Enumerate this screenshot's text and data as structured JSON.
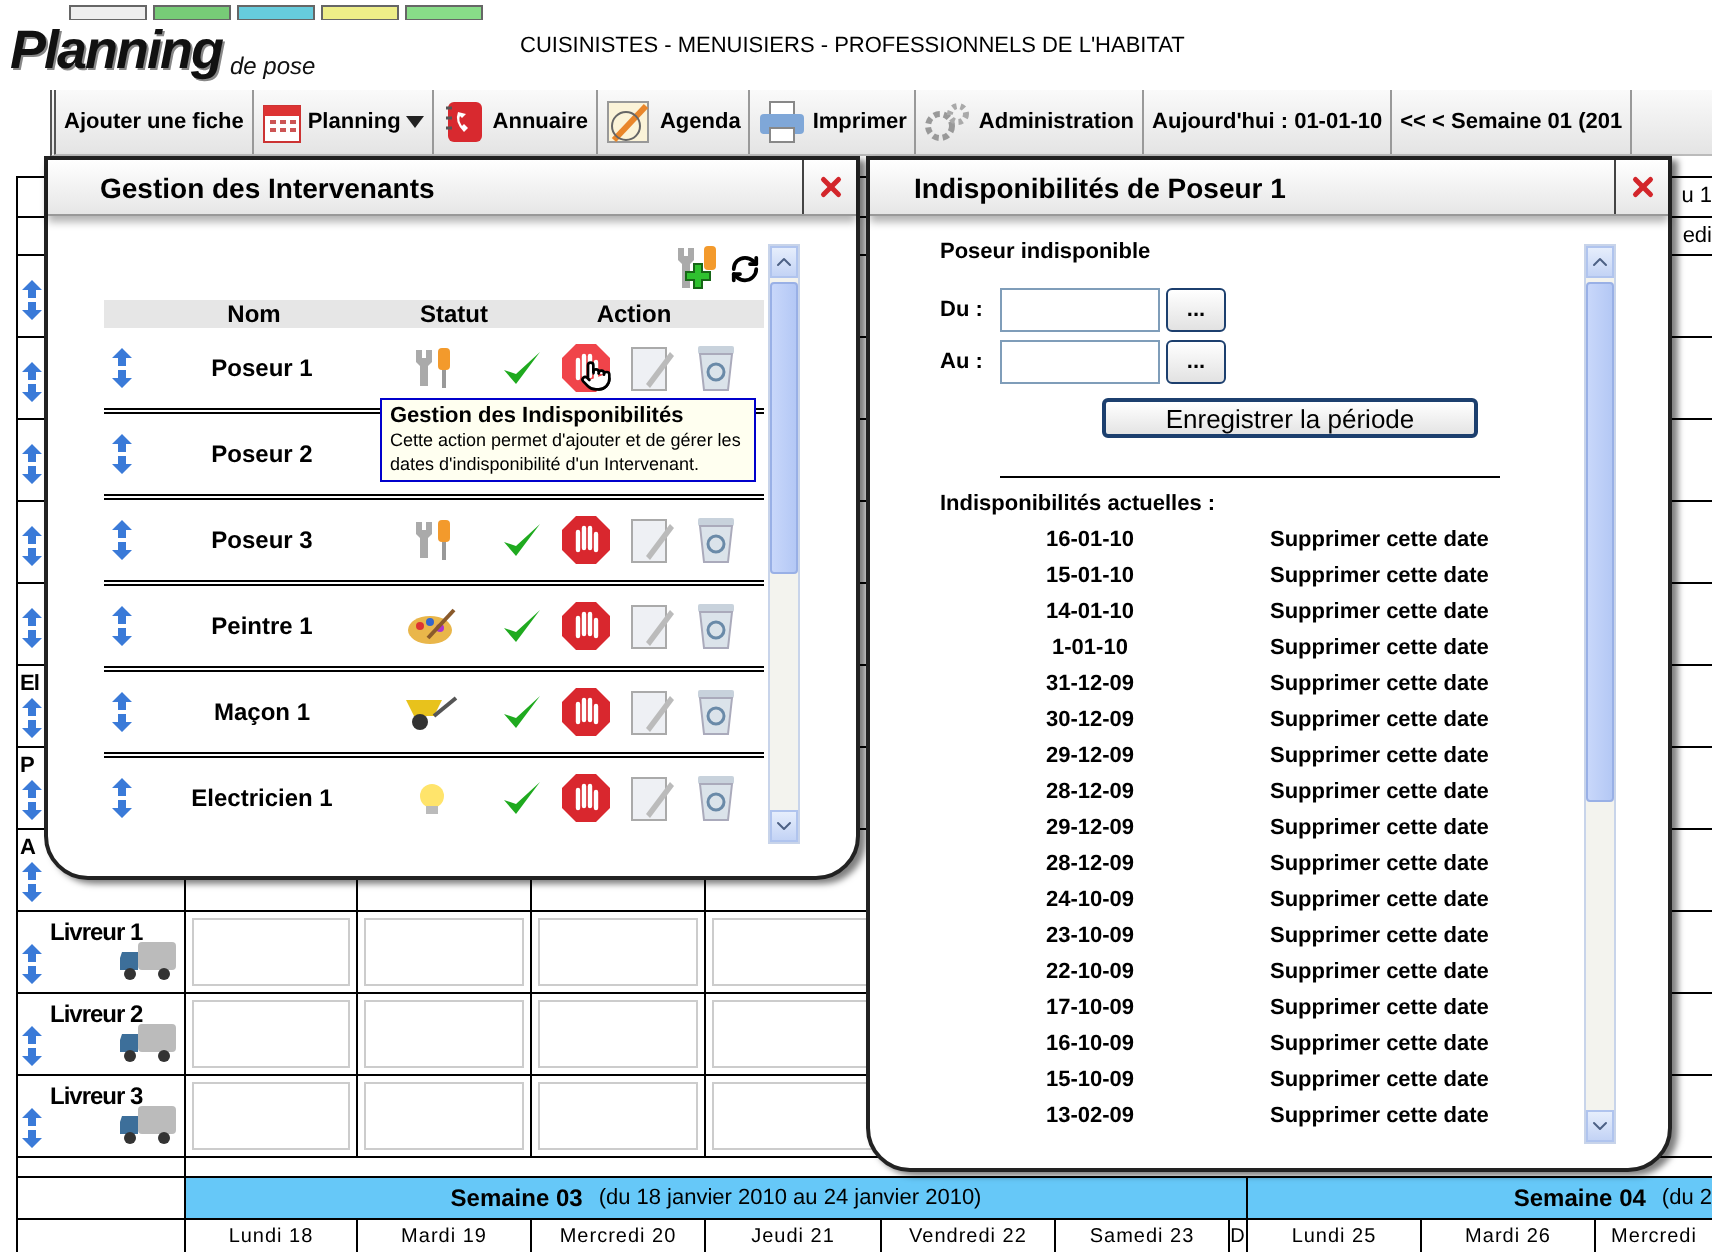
{
  "header": {
    "logo_title": "Planning",
    "logo_subtitle": "de pose",
    "tagline": "CUISINISTES - MENUISIERS - PROFESSIONNELS DE L'HABITAT"
  },
  "toolbar": [
    {
      "label": "Ajouter une fiche",
      "kind": "plain",
      "dropdown": false
    },
    {
      "label": "Planning",
      "kind": "calendar",
      "dropdown": true
    },
    {
      "label": "Annuaire",
      "kind": "phonebook",
      "dropdown": false
    },
    {
      "label": "Agenda",
      "kind": "agenda",
      "dropdown": false
    },
    {
      "label": "Imprimer",
      "kind": "printer",
      "dropdown": false
    },
    {
      "label": "Administration",
      "kind": "gears",
      "dropdown": false
    },
    {
      "label": "Aujourd'hui : 01-01-10",
      "kind": "plain",
      "dropdown": false
    },
    {
      "label": "<< < Semaine 01 (201",
      "kind": "plain",
      "dropdown": false
    }
  ],
  "planning": {
    "top_week": "u 1",
    "top_day": "edi",
    "rows": [
      {
        "kind": "person"
      },
      {
        "kind": "person"
      },
      {
        "kind": "person"
      },
      {
        "kind": "person"
      },
      {
        "kind": "person"
      },
      {
        "kind": "person",
        "label": "El"
      },
      {
        "kind": "person",
        "label": "P"
      },
      {
        "kind": "person",
        "label": "A"
      },
      {
        "kind": "truck",
        "label": "Livreur 1"
      },
      {
        "kind": "truck",
        "label": "Livreur 2"
      },
      {
        "kind": "truck",
        "label": "Livreur 3"
      }
    ],
    "weeks": [
      {
        "title": "Semaine 03",
        "range": "(du 18 janvier 2010 au 24 janvier 2010)"
      },
      {
        "title": "Semaine 04",
        "range": "(du 2"
      }
    ],
    "days": [
      "Lundi 18",
      "Mardi 19",
      "Mercredi 20",
      "Jeudi 21",
      "Vendredi 22",
      "Samedi 23",
      "D",
      "Lundi 25",
      "Mardi 26",
      "Mercredi"
    ]
  },
  "intervenants_dialog": {
    "title": "Gestion des Intervenants",
    "columns": [
      "Nom",
      "Statut",
      "Action"
    ],
    "rows": [
      {
        "name": "Poseur 1",
        "kind": "tools",
        "active": true,
        "hovered": true
      },
      {
        "name": "Poseur 2"
      },
      {
        "name": "Poseur 3",
        "kind": "tools",
        "active": true,
        "hovered": false
      },
      {
        "name": "Peintre 1",
        "kind": "palette",
        "active": true,
        "hovered": false
      },
      {
        "name": "Maçon 1",
        "kind": "wheelbarrow",
        "active": true,
        "hovered": false
      },
      {
        "name": "Electricien 1",
        "kind": "bulb",
        "active": true,
        "hovered": false
      }
    ],
    "tooltip": {
      "title": "Gestion des Indisponibilités",
      "text": "Cette action permet d'ajouter et de gérer les dates d'indisponibilité d'un Intervenant."
    }
  },
  "indispo_dialog": {
    "title": "Indisponibilités de Poseur 1",
    "subtitle": "Poseur indisponible",
    "fields": [
      {
        "label": "Du :",
        "picker": "..."
      },
      {
        "label": "Au :",
        "picker": "..."
      }
    ],
    "save_button": "Enregistrer la période",
    "list_heading": "Indisponibilités actuelles :",
    "dates": [
      {
        "date": "16-01-10",
        "action": "Supprimer cette date"
      },
      {
        "date": "15-01-10",
        "action": "Supprimer cette date"
      },
      {
        "date": "14-01-10",
        "action": "Supprimer cette date"
      },
      {
        "date": "1-01-10",
        "action": "Supprimer cette date"
      },
      {
        "date": "31-12-09",
        "action": "Supprimer cette date"
      },
      {
        "date": "30-12-09",
        "action": "Supprimer cette date"
      },
      {
        "date": "29-12-09",
        "action": "Supprimer cette date"
      },
      {
        "date": "28-12-09",
        "action": "Supprimer cette date"
      },
      {
        "date": "29-12-09",
        "action": "Supprimer cette date"
      },
      {
        "date": "28-12-09",
        "action": "Supprimer cette date"
      },
      {
        "date": "24-10-09",
        "action": "Supprimer cette date"
      },
      {
        "date": "23-10-09",
        "action": "Supprimer cette date"
      },
      {
        "date": "22-10-09",
        "action": "Supprimer cette date"
      },
      {
        "date": "17-10-09",
        "action": "Supprimer cette date"
      },
      {
        "date": "16-10-09",
        "action": "Supprimer cette date"
      },
      {
        "date": "15-10-09",
        "action": "Supprimer cette date"
      },
      {
        "date": "13-02-09",
        "action": "Supprimer cette date"
      }
    ]
  }
}
